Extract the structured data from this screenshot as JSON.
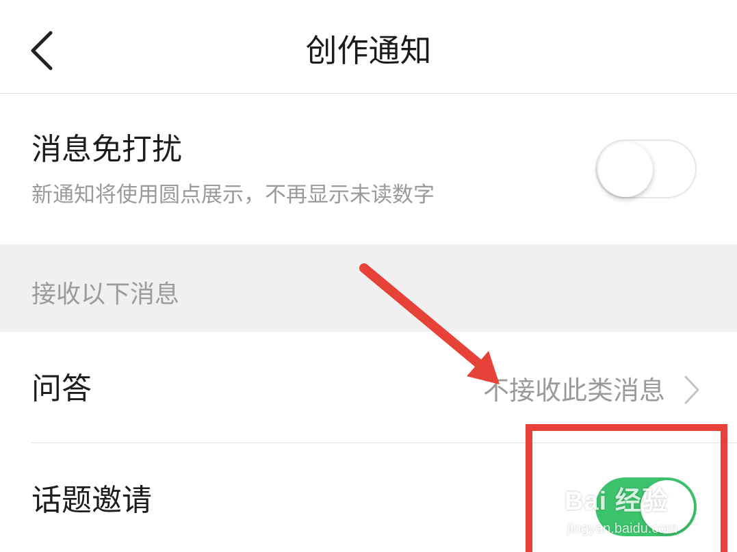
{
  "header": {
    "title": "创作通知",
    "back_icon": "chevron-left-icon"
  },
  "do_not_disturb": {
    "title": "消息免打扰",
    "subtitle": "新通知将使用圆点展示，不再显示未读数字",
    "toggle_state": "off"
  },
  "section": {
    "label": "接收以下消息"
  },
  "qa": {
    "title": "问答",
    "value": "不接收此类消息",
    "chevron_icon": "chevron-right-icon"
  },
  "topic_invite": {
    "title": "话题邀请",
    "toggle_state": "on"
  },
  "annotations": {
    "arrow_color": "#e7423a",
    "box_color": "#e7423a"
  },
  "watermark": {
    "brand": "Bai  经验",
    "url": "jingyan.baidu.com"
  },
  "colors": {
    "toggle_on": "#3cc46d",
    "secondary_text": "#9a9a9a",
    "section_bg": "#f0f0f0"
  }
}
